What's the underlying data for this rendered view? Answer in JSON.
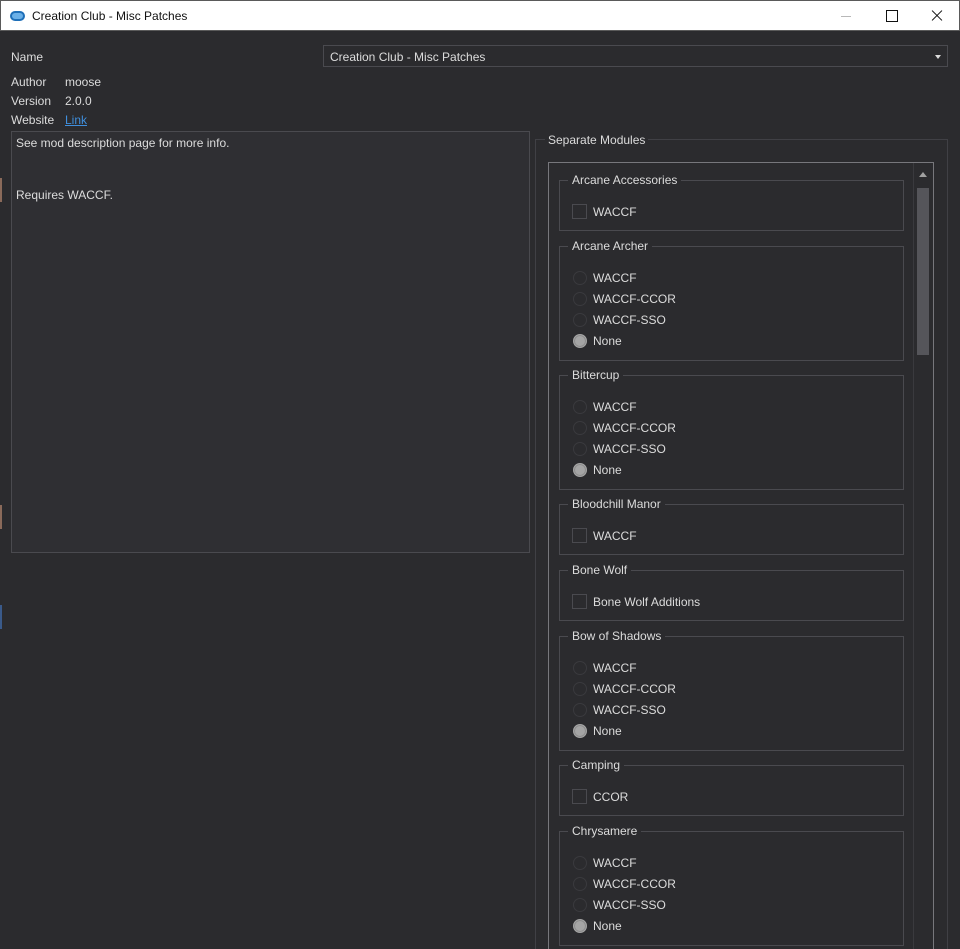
{
  "window": {
    "title": "Creation Club - Misc Patches"
  },
  "form": {
    "name_label": "Name",
    "name_value": "Creation Club - Misc Patches",
    "author_label": "Author",
    "author_value": "moose",
    "version_label": "Version",
    "version_value": "2.0.0",
    "website_label": "Website",
    "website_link": "Link"
  },
  "description": {
    "line1": "See mod description page for more info.",
    "line2": "Requires WACCF."
  },
  "modules": {
    "title": "Separate Modules",
    "groups": [
      {
        "title": "Arcane Accessories",
        "options": [
          {
            "label": "WACCF"
          }
        ]
      },
      {
        "title": "Arcane Archer",
        "options": [
          {
            "label": "WACCF"
          },
          {
            "label": "WACCF-CCOR"
          },
          {
            "label": "WACCF-SSO"
          },
          {
            "label": "None"
          }
        ]
      },
      {
        "title": "Bittercup",
        "options": [
          {
            "label": "WACCF"
          },
          {
            "label": "WACCF-CCOR"
          },
          {
            "label": "WACCF-SSO"
          },
          {
            "label": "None"
          }
        ]
      },
      {
        "title": "Bloodchill Manor",
        "options": [
          {
            "label": "WACCF"
          }
        ]
      },
      {
        "title": "Bone Wolf",
        "options": [
          {
            "label": "Bone Wolf Additions"
          }
        ]
      },
      {
        "title": "Bow of Shadows",
        "options": [
          {
            "label": "WACCF"
          },
          {
            "label": "WACCF-CCOR"
          },
          {
            "label": "WACCF-SSO"
          },
          {
            "label": "None"
          }
        ]
      },
      {
        "title": "Camping",
        "options": [
          {
            "label": "CCOR"
          }
        ]
      },
      {
        "title": "Chrysamere",
        "options": [
          {
            "label": "WACCF"
          },
          {
            "label": "WACCF-CCOR"
          },
          {
            "label": "WACCF-SSO"
          },
          {
            "label": "None"
          }
        ]
      }
    ]
  }
}
